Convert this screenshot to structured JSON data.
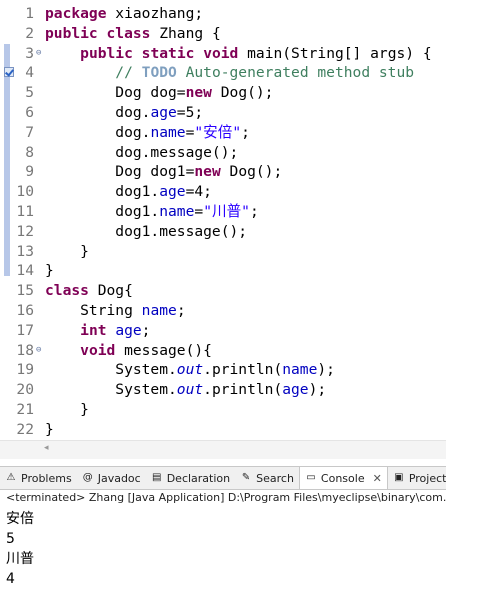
{
  "editor": {
    "lines": [
      {
        "n": "1",
        "tokens": [
          [
            "kw",
            "package"
          ],
          [
            "",
            "xiaozhang;"
          ]
        ]
      },
      {
        "n": "2",
        "tokens": [
          [
            "kw",
            "public"
          ],
          [
            "",
            ""
          ],
          [
            "kw",
            "class"
          ],
          [
            "",
            "Zhang {"
          ]
        ]
      },
      {
        "n": "3",
        "tokens": [
          [
            "",
            "    "
          ],
          [
            "kw",
            "public"
          ],
          [
            "kw",
            "static"
          ],
          [
            "kw",
            "void"
          ],
          [
            "",
            "main(String[] args) {"
          ]
        ]
      },
      {
        "n": "4",
        "tokens": [
          [
            "cmt",
            "        // "
          ],
          [
            "todo",
            "TODO"
          ],
          [
            "cmt",
            "Auto-generated method stub"
          ]
        ]
      },
      {
        "n": "5",
        "tokens": [
          [
            "",
            "        Dog dog="
          ],
          [
            "kw",
            "new"
          ],
          [
            "",
            "Dog();"
          ]
        ]
      },
      {
        "n": "6",
        "tokens": [
          [
            "",
            "        dog."
          ],
          [
            "fld",
            "age"
          ],
          [
            "",
            "=5;"
          ]
        ]
      },
      {
        "n": "7",
        "tokens": [
          [
            "",
            "        dog."
          ],
          [
            "fld",
            "name"
          ],
          [
            "",
            "="
          ],
          [
            "str",
            "\"安倍\""
          ],
          [
            "",
            ";"
          ]
        ]
      },
      {
        "n": "8",
        "tokens": [
          [
            "",
            "        dog.message();"
          ]
        ]
      },
      {
        "n": "9",
        "tokens": [
          [
            "",
            "        Dog dog1="
          ],
          [
            "kw",
            "new"
          ],
          [
            "",
            "Dog();"
          ]
        ]
      },
      {
        "n": "10",
        "tokens": [
          [
            "",
            "        dog1."
          ],
          [
            "fld",
            "age"
          ],
          [
            "",
            "=4;"
          ]
        ]
      },
      {
        "n": "11",
        "tokens": [
          [
            "",
            "        dog1."
          ],
          [
            "fld",
            "name"
          ],
          [
            "",
            "="
          ],
          [
            "str",
            "\"川普\""
          ],
          [
            "",
            ";"
          ]
        ]
      },
      {
        "n": "12",
        "tokens": [
          [
            "",
            "        dog1.message();"
          ]
        ]
      },
      {
        "n": "13",
        "tokens": [
          [
            "",
            "    }"
          ]
        ]
      },
      {
        "n": "14",
        "tokens": [
          [
            "",
            "}"
          ]
        ]
      },
      {
        "n": "15",
        "tokens": [
          [
            "kw",
            "class"
          ],
          [
            "",
            "Dog{"
          ]
        ]
      },
      {
        "n": "16",
        "tokens": [
          [
            "",
            "    String "
          ],
          [
            "fld",
            "name"
          ],
          [
            "",
            ";"
          ]
        ]
      },
      {
        "n": "17",
        "tokens": [
          [
            "",
            "    "
          ],
          [
            "kw",
            "int"
          ],
          [
            "fld",
            "age"
          ],
          [
            "",
            ";"
          ]
        ]
      },
      {
        "n": "18",
        "tokens": [
          [
            "",
            "    "
          ],
          [
            "kw",
            "void"
          ],
          [
            "",
            "message(){"
          ]
        ]
      },
      {
        "n": "19",
        "tokens": [
          [
            "",
            "        System."
          ],
          [
            "sfld",
            "out"
          ],
          [
            "",
            ".println("
          ],
          [
            "fld",
            "name"
          ],
          [
            "",
            ");"
          ]
        ]
      },
      {
        "n": "20",
        "tokens": [
          [
            "",
            "        System."
          ],
          [
            "sfld",
            "out"
          ],
          [
            "",
            ".println("
          ],
          [
            "fld",
            "age"
          ],
          [
            "",
            ");"
          ]
        ]
      },
      {
        "n": "21",
        "tokens": [
          [
            "",
            "    }"
          ]
        ]
      },
      {
        "n": "22",
        "tokens": [
          [
            "",
            "}"
          ]
        ]
      }
    ],
    "folds": [
      "3",
      "18"
    ],
    "task_line": "4",
    "scroll_arrow": "◂"
  },
  "tabs": [
    {
      "name": "tab-problems",
      "icon": "problems-icon",
      "glyph": "⚠",
      "label": "Problems",
      "active": false
    },
    {
      "name": "tab-javadoc",
      "icon": "at-icon",
      "glyph": "@",
      "label": "Javadoc",
      "active": false
    },
    {
      "name": "tab-declaration",
      "icon": "declaration-icon",
      "glyph": "▤",
      "label": "Declaration",
      "active": false
    },
    {
      "name": "tab-search",
      "icon": "search-icon",
      "glyph": "✎",
      "label": "Search",
      "active": false
    },
    {
      "name": "tab-console",
      "icon": "console-icon",
      "glyph": "▭",
      "label": "Console",
      "active": true,
      "close": "✕"
    },
    {
      "name": "tab-project-migration",
      "icon": "project-migration-icon",
      "glyph": "▣",
      "label": "Project Migra",
      "active": false
    }
  ],
  "console": {
    "header": "<terminated> Zhang [Java Application] D:\\Program Files\\myeclipse\\binary\\com.sun.j",
    "output": [
      "安倍",
      "5",
      "川普",
      "4"
    ]
  }
}
